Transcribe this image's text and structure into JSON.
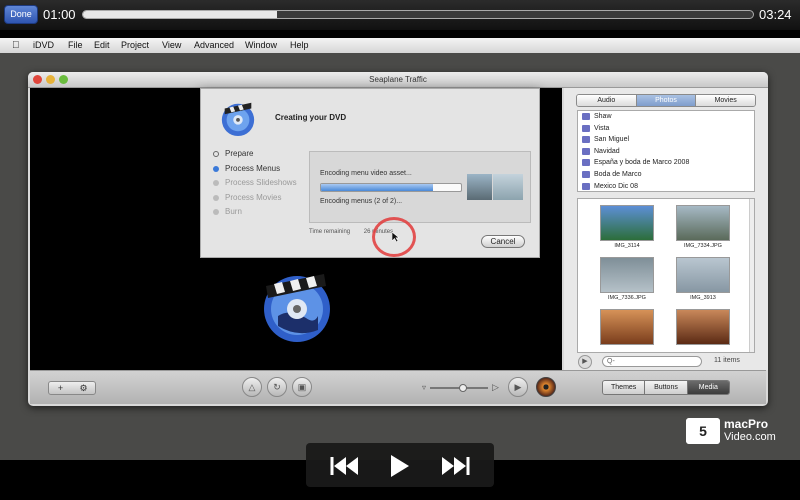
{
  "player": {
    "done_label": "Done",
    "time_elapsed": "01:00",
    "time_remaining": "03:24",
    "progress_fraction": 0.29
  },
  "menubar": {
    "items": [
      "iDVD",
      "File",
      "Edit",
      "Project",
      "View",
      "Advanced",
      "Window",
      "Help"
    ]
  },
  "window": {
    "title": "Seaplane Traffic"
  },
  "sheet": {
    "title": "Creating your DVD",
    "steps": [
      {
        "label": "Prepare",
        "state": "done"
      },
      {
        "label": "Process Menus",
        "state": "active"
      },
      {
        "label": "Process Slideshows",
        "state": "pending"
      },
      {
        "label": "Process Movies",
        "state": "pending"
      },
      {
        "label": "Burn",
        "state": "pending"
      }
    ],
    "encoding_label": "Encoding menu video asset...",
    "encoding_sub": "Encoding menus (2 of 2)...",
    "encoding_fraction": 0.8,
    "time_label": "Time remaining",
    "time_value": "26 minutes",
    "cancel_label": "Cancel"
  },
  "media": {
    "tabs": [
      "Audio",
      "Photos",
      "Movies"
    ],
    "selected_tab": "Photos",
    "albums": [
      "Shaw",
      "Vista",
      "San Miguel",
      "Navidad",
      "España y boda de Marco 2008",
      "Boda de Marco",
      "Mexico Dic 08"
    ],
    "photos": [
      {
        "caption": "IMG_3114",
        "color_top": "#5d8fd6",
        "color_bottom": "#2c6e3a"
      },
      {
        "caption": "IMG_7334.JPG",
        "color_top": "#a6b9c5",
        "color_bottom": "#5a6a5a"
      },
      {
        "caption": "IMG_7336.JPG",
        "color_top": "#7f8f98",
        "color_bottom": "#b5c1c8"
      },
      {
        "caption": "IMG_3913",
        "color_top": "#b9c6d0",
        "color_bottom": "#8797a3"
      },
      {
        "caption": "",
        "color_top": "#d69258",
        "color_bottom": "#7a3d1c"
      },
      {
        "caption": "",
        "color_top": "#c9885a",
        "color_bottom": "#5b2a14"
      }
    ],
    "search_placeholder": "Q-",
    "item_count": "11 items"
  },
  "toolbar": {
    "add_label": "+",
    "settings_label": "⚙",
    "modes": [
      "Themes",
      "Buttons",
      "Media"
    ],
    "selected_mode": "Media",
    "volume_fraction": 0.5
  },
  "brand": {
    "line1": "macPro",
    "line2": "Video.com"
  },
  "colors": {
    "accent": "#3b7ad9",
    "highlight_circle": "#e23a3a"
  }
}
